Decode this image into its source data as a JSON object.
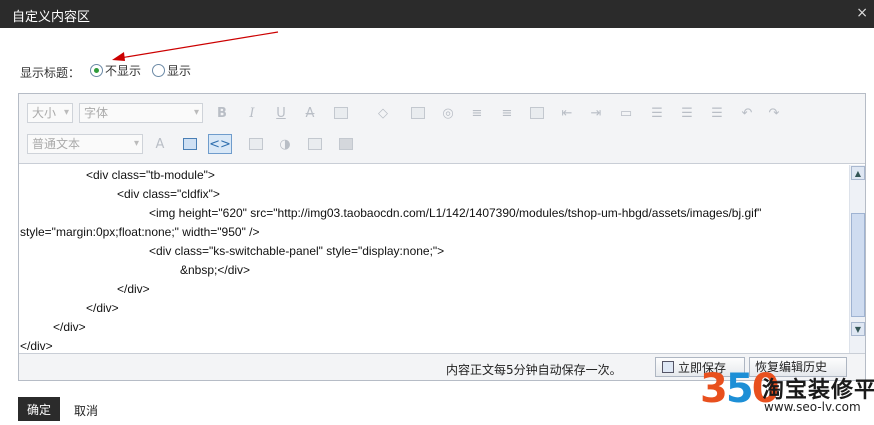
{
  "dialog": {
    "title": "自定义内容区",
    "close_glyph": "×"
  },
  "display_title": {
    "label": "显示标题：",
    "options": [
      "不显示",
      "显示"
    ],
    "selected": "不显示"
  },
  "toolbar": {
    "size_select": "大小",
    "font_select": "字体",
    "format_select": "普通文本",
    "bold": "B",
    "italic": "I",
    "underline": "U",
    "strike": "A",
    "source_active": true
  },
  "code_lines": [
    "<div class=\"tb-module\">",
    "<div class=\"cldfix\">",
    "<img height=\"620\" src=\"http://img03.taobaocdn.com/L1/142/1407390/modules/tshop-um-hbgd/assets/images/bj.gif\"",
    "style=\"margin:0px;float:none;\" width=\"950\" />",
    "<div class=\"ks-switchable-panel\" style=\"display:none;\">",
    "&nbsp;</div>",
    "</div>",
    "</div>",
    "</div>",
    "</div>"
  ],
  "status": {
    "autosave_msg": "内容正文每5分钟自动保存一次。",
    "save_now": "立即保存",
    "restore_history": "恢复编辑历史"
  },
  "footer": {
    "ok": "确定",
    "cancel": "取消"
  },
  "watermark": {
    "digits": [
      "3",
      "5",
      "0"
    ],
    "name": "淘宝装修平台",
    "url": "www.seo-lv.com"
  },
  "colors": {
    "titlebar": "#2b2b2b",
    "radio_selected": "#2e9b3a",
    "arrow": "#cc0000",
    "logo_orange": "#e8501e",
    "logo_blue": "#1d8fd6"
  }
}
